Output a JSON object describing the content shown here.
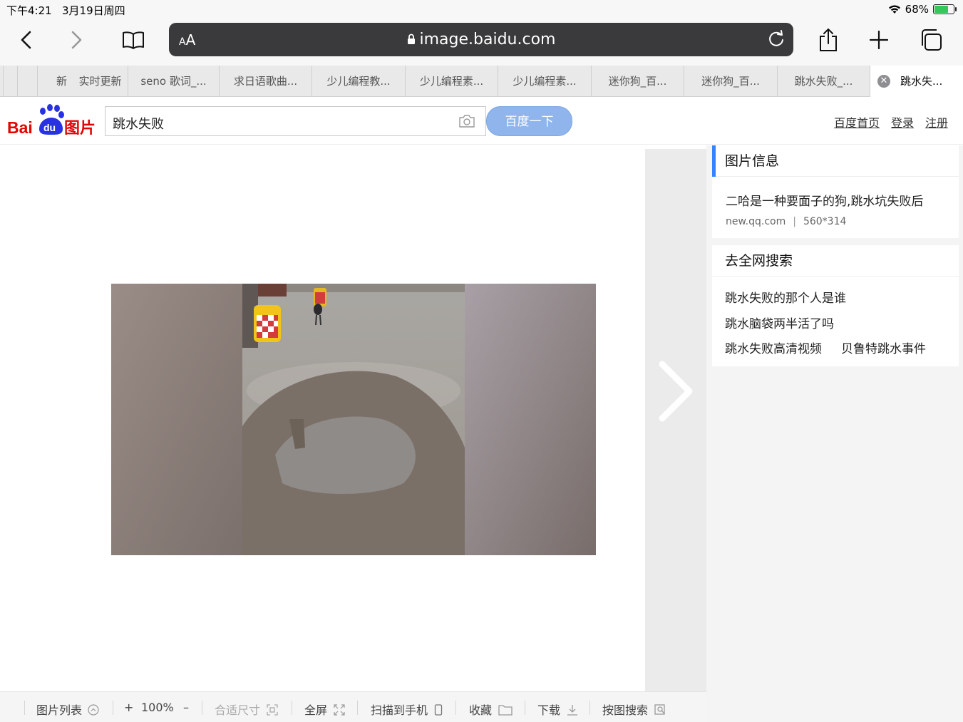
{
  "status_bar": {
    "time": "下午4:21",
    "date": "3月19日周四",
    "battery": "68%",
    "battery_level": 0.68
  },
  "browser": {
    "text_size_label": "AA",
    "url_host": "image.baidu.com",
    "icons": [
      "back-icon",
      "forward-icon",
      "bookmarks-icon",
      "lock-icon",
      "reload-icon",
      "share-icon",
      "new-tab-icon",
      "tabs-overview-icon"
    ]
  },
  "tabs": [
    {
      "label": "新"
    },
    {
      "label": "实时更新"
    },
    {
      "label": "seno 歌词_..."
    },
    {
      "label": "求日语歌曲..."
    },
    {
      "label": "少儿编程教..."
    },
    {
      "label": "少儿编程素..."
    },
    {
      "label": "少儿编程素..."
    },
    {
      "label": "迷你狗_百..."
    },
    {
      "label": "迷你狗_百..."
    },
    {
      "label": "跳水失败_..."
    },
    {
      "label": "跳水失...",
      "active": true
    }
  ],
  "baidu": {
    "logo_text": "Bai du 图片",
    "query": "跳水失败",
    "search_button": "百度一下",
    "links": [
      "百度首页",
      "登录",
      "注册"
    ]
  },
  "image_info": {
    "title": "图片信息",
    "description": "二哈是一种要面子的狗,跳水坑失败后",
    "source": "new.qq.com",
    "separator": "|",
    "size": "560*314"
  },
  "related": {
    "title": "去全网搜索",
    "items": [
      "跳水失败的那个人是谁",
      "跳水脑袋两半活了吗",
      "跳水失败高清视频",
      "贝鲁特跳水事件"
    ]
  },
  "bottom_bar": {
    "list": "图片列表",
    "zoom_in": "+",
    "zoom": "100%",
    "zoom_out": "–",
    "fit": "合适尺寸",
    "fullscreen": "全屏",
    "scan": "扫描到手机",
    "collect": "收藏",
    "download": "下载",
    "search_by_image": "按图搜索"
  },
  "colors": {
    "baidu_red": "#e10602",
    "baidu_blue": "#2932e1",
    "accent_blue": "#3385ff",
    "search_button": "#8fb5ec",
    "battery_green": "#35c759"
  }
}
